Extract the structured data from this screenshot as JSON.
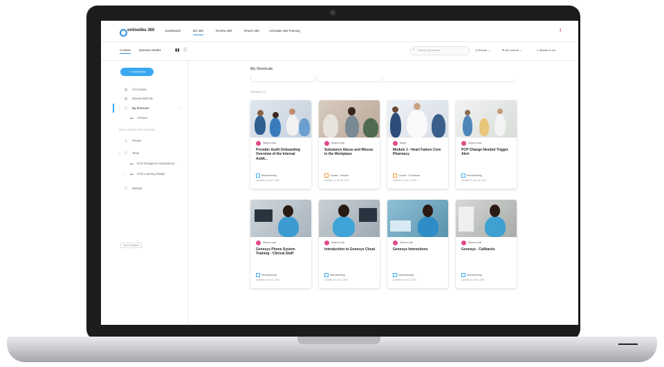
{
  "colors": {
    "accent": "#39a8f0",
    "avatar": "#e04a8b",
    "alert": "#e0245e"
  },
  "app": {
    "logo": "onlinelike 360",
    "nav": [
      "Dashboard",
      "Biz 360",
      "Review 360",
      "Reach 360",
      "Articulate 360 Training"
    ],
    "nav_active_index": 1,
    "alert": "!"
  },
  "subbar": {
    "tabs": [
      "Content",
      "Question Banks"
    ],
    "search_placeholder": "Search all content",
    "recent": "Recent",
    "all_content": "All Content",
    "shared": "Shared to me"
  },
  "sidebar": {
    "create_label": "+ Create New",
    "items": [
      "All Content",
      "Shared With Me",
      "My Shortcuts",
      "All Docs"
    ],
    "section_label": "MANY CONTENT ARE CHANGED",
    "items2": [
      "Private",
      "Team",
      "PCO Designers Associate Ex...",
      "PCO Learning Design",
      "Deleted"
    ],
    "footer": "Send feedback"
  },
  "main": {
    "title": "My Shortcuts",
    "count_label": "Shortcuts (17)",
    "cards": [
      {
        "author": "Sharon Link",
        "title": "Provider Audit Onboarding Overview of the Internal Audit...",
        "tag": "Microlearning",
        "tag_color": "blue",
        "updated": "Updated on Jan 3, 2024"
      },
      {
        "author": "Sharon Link",
        "title": "Substance Abuse and Misuse in the Workplace",
        "tag": "Course · Version",
        "tag_color": "orange",
        "updated": "Updated on Jan 29, 2024"
      },
      {
        "author": "Molly",
        "title": "Module 1 - Heart Failure Core Pharmacy",
        "tag": "Course · 6 Lessons",
        "tag_color": "orange",
        "updated": "Updated on Jan 3, 2024"
      },
      {
        "author": "Sharon Link",
        "title": "PCP Change Needed Trigger Alert",
        "tag": "Microlearning",
        "tag_color": "blue",
        "updated": "Updated on Jan 18, 2024"
      },
      {
        "author": "Sharon Link",
        "title": "Genesys Phone System Training - Clinical Staff",
        "tag": "Microlearning",
        "tag_color": "blue",
        "updated": "Updated on Jan 2, 2024"
      },
      {
        "author": "Sharon Link",
        "title": "Introduction to Genesys Cloud",
        "tag": "Microlearning",
        "tag_color": "blue",
        "updated": "Updated on Jan 2, 2024"
      },
      {
        "author": "Sharon Link",
        "title": "Genesys Interactions",
        "tag": "Microlearning",
        "tag_color": "blue",
        "updated": "Updated on Jan 2, 2024"
      },
      {
        "author": "Sharon Link",
        "title": "Genesys - Callbacks",
        "tag": "Microlearning",
        "tag_color": "blue",
        "updated": "Updated on Jan 2, 2024"
      }
    ]
  }
}
